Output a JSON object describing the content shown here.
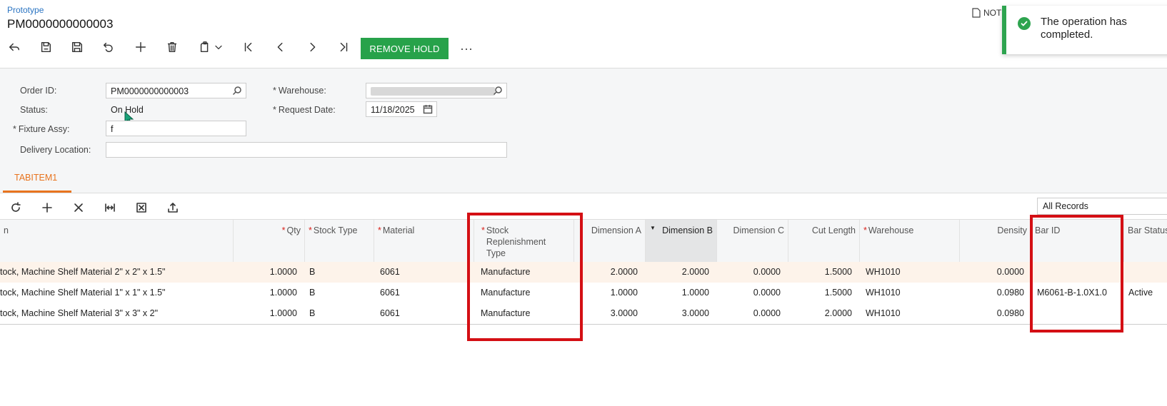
{
  "header": {
    "breadcrumb": "Prototype",
    "title": "PM0000000000003",
    "notes_label": "NOT",
    "remove_hold_label": "REMOVE HOLD",
    "more_label": "···"
  },
  "toast": {
    "message": "The operation has completed."
  },
  "form": {
    "order_id_label": "Order ID:",
    "order_id_value": "PM0000000000003",
    "status_label": "Status:",
    "status_value": "On Hold",
    "fixture_label": "Fixture Assy:",
    "fixture_value": "f",
    "delivery_label": "Delivery Location:",
    "delivery_value": "",
    "warehouse_label": "Warehouse:",
    "request_date_label": "Request Date:",
    "request_date_value": "11/18/2025",
    "required_mark": "*"
  },
  "tabs": [
    {
      "label": "TABITEM1"
    }
  ],
  "grid_toolbar": {
    "filter_value": "All Records"
  },
  "grid": {
    "columns": [
      {
        "label": "n",
        "required": false
      },
      {
        "label": "Qty",
        "required": true
      },
      {
        "label": "Stock Type",
        "required": true
      },
      {
        "label": "Material",
        "required": true
      },
      {
        "label": "Stock Replenishment Type",
        "required": true
      },
      {
        "label": "Dimension A",
        "required": false
      },
      {
        "label": "Dimension B",
        "required": false
      },
      {
        "label": "Dimension C",
        "required": false
      },
      {
        "label": "Cut Length",
        "required": false
      },
      {
        "label": "Warehouse",
        "required": true
      },
      {
        "label": "Density",
        "required": false
      },
      {
        "label": "Bar ID",
        "required": false
      },
      {
        "label": "Bar Status",
        "required": false
      }
    ],
    "rows": [
      [
        "tock, Machine Shelf Material 2\" x 2\" x 1.5\"",
        "1.0000",
        "B",
        "6061",
        "Manufacture",
        "2.0000",
        "2.0000",
        "0.0000",
        "1.5000",
        "WH1010",
        "0.0000",
        "",
        ""
      ],
      [
        "tock, Machine Shelf Material 1\" x 1\" x 1.5\"",
        "1.0000",
        "B",
        "6061",
        "Manufacture",
        "1.0000",
        "1.0000",
        "0.0000",
        "1.5000",
        "WH1010",
        "0.0980",
        "M6061-B-1.0X1.0",
        "Active"
      ],
      [
        "tock, Machine Shelf Material 3\" x 3\" x 2\"",
        "1.0000",
        "B",
        "6061",
        "Manufacture",
        "3.0000",
        "3.0000",
        "0.0000",
        "2.0000",
        "WH1010",
        "0.0980",
        "",
        ""
      ]
    ]
  },
  "colors": {
    "accent_green": "#27a24a",
    "tab_orange": "#e8741f",
    "highlight_red": "#d40f14",
    "selected_row": "#fdf3ea"
  }
}
